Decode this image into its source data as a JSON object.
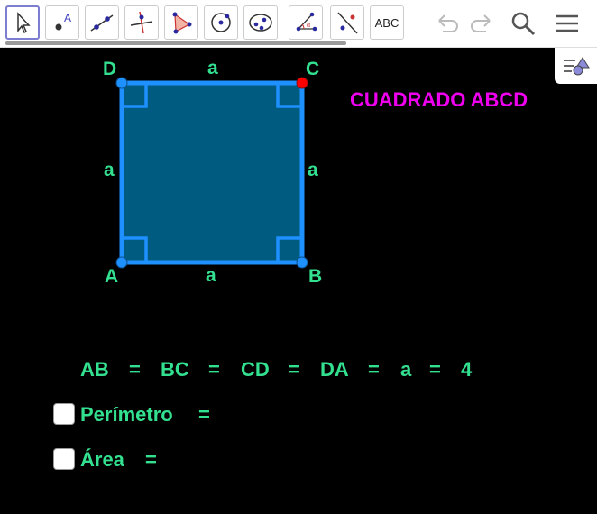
{
  "toolbar": {
    "tools": [
      "move-tool",
      "point-tool",
      "line-tool",
      "perpendicular-tool",
      "polygon-tool",
      "circle-tool",
      "ellipse-tool",
      "angle-tool",
      "reflect-tool",
      "text-tool"
    ],
    "text_tool_label": "ABC",
    "undo": "undo-icon",
    "redo": "redo-icon",
    "search": "search-icon",
    "menu": "menu-icon"
  },
  "figure": {
    "vertices": {
      "A": "A",
      "B": "B",
      "C": "C",
      "D": "D"
    },
    "side_labels": {
      "top": "a",
      "bottom": "a",
      "left": "a",
      "right": "a"
    },
    "fill_color": "#005b80",
    "edge_color": "#1e90ff",
    "point_color": "#1e90ff",
    "highlight_point_color": "#ff0000"
  },
  "title": "CUADRADO ABCD",
  "equation": [
    "AB",
    "=",
    "BC",
    "=",
    "CD",
    "=",
    "DA",
    "=",
    "a",
    "=",
    "4"
  ],
  "checkboxes": [
    {
      "label": "Perímetro",
      "eq": "="
    },
    {
      "label": "Área",
      "eq": "="
    }
  ]
}
